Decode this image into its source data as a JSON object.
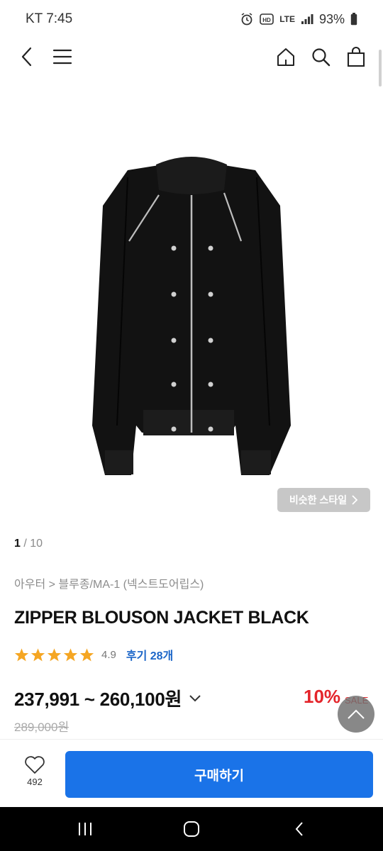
{
  "status_bar": {
    "carrier_time": "KT 7:45",
    "network": "LTE",
    "battery": "93%",
    "icons": [
      "alarm-icon",
      "hd-icon",
      "lte-icon",
      "signal-icon",
      "battery-icon"
    ]
  },
  "nav": {
    "icons": [
      "back-icon",
      "menu-icon",
      "home-icon",
      "search-icon",
      "cart-icon"
    ]
  },
  "gallery": {
    "similar_style_label": "비슷한 스타일",
    "current": "1",
    "separator": " / ",
    "total": "10"
  },
  "product": {
    "breadcrumb": "아우터 > 블루종/MA-1 (넥스트도어립스)",
    "title": "ZIPPER BLOUSON JACKET BLACK",
    "rating": "4.9",
    "rating_stars": 5,
    "review_label": "후기 28개",
    "price_range": "237,991 ~ 260,100원",
    "discount": "10%",
    "sale_label": "SALE",
    "original_price": "289,000원"
  },
  "bottom_bar": {
    "like_count": "492",
    "buy_label": "구매하기"
  },
  "colors": {
    "accent": "#1a73e8",
    "sale_red": "#e4242a",
    "star": "#f5a623",
    "review_blue": "#1c66c8"
  }
}
